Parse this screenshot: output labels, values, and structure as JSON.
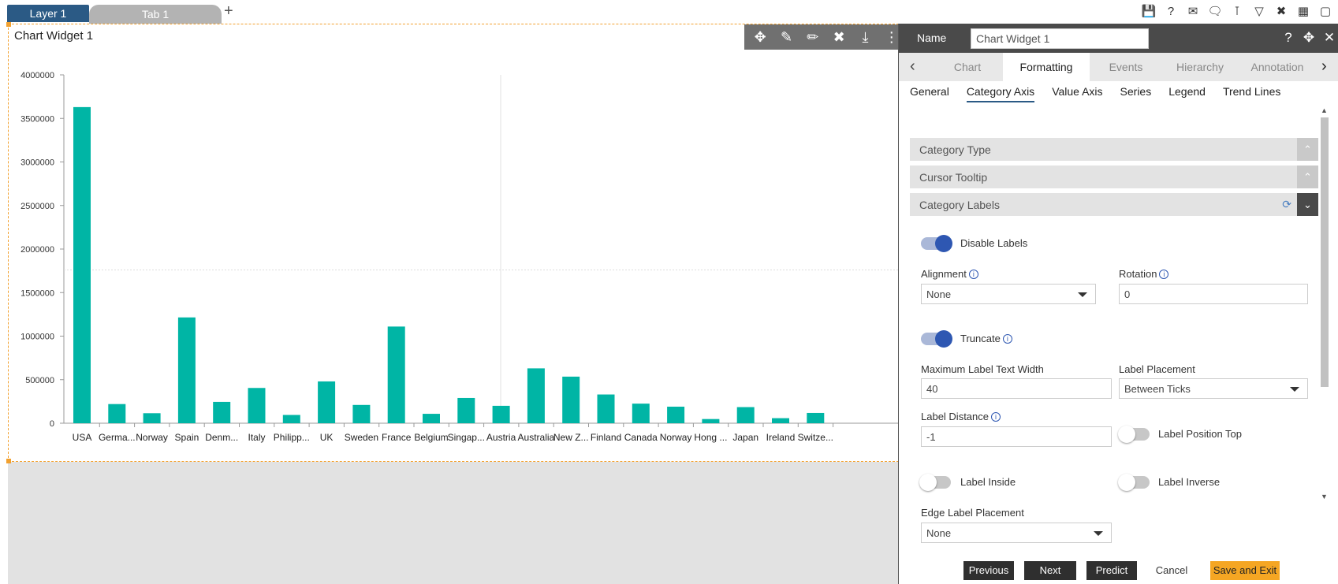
{
  "topbar": {
    "layer_tab": "Layer 1",
    "tab": "Tab 1",
    "add": "+",
    "icons": [
      "save-icon",
      "help-icon",
      "mail-icon",
      "comment-icon",
      "filter-clear-icon",
      "filter-icon",
      "tools-icon",
      "table-icon",
      "monitor-icon"
    ]
  },
  "widget": {
    "title": "Chart Widget 1",
    "toolbar_icons": [
      "move-icon",
      "draw-icon",
      "edit-icon",
      "settings-icon",
      "download-icon",
      "more-icon"
    ]
  },
  "chart_data": {
    "type": "bar",
    "categories": [
      "USA",
      "Germa...",
      "Norway",
      "Spain",
      "Denm...",
      "Italy",
      "Philipp...",
      "UK",
      "Sweden",
      "France",
      "Belgium",
      "Singap...",
      "Austria",
      "Australia",
      "New Z...",
      "Finland",
      "Canada",
      "Norway",
      "Hong ...",
      "Japan",
      "Ireland",
      "Switze..."
    ],
    "values": [
      3630000,
      220000,
      115000,
      1215000,
      245000,
      405000,
      95000,
      480000,
      210000,
      1110000,
      108000,
      290000,
      200000,
      630000,
      535000,
      330000,
      225000,
      190000,
      48000,
      185000,
      58000,
      118000
    ],
    "yticks": [
      "0",
      "500000",
      "1000000",
      "1500000",
      "2000000",
      "2500000",
      "3000000",
      "3500000",
      "4000000"
    ],
    "ylim": [
      0,
      4000000
    ],
    "color": "#00b5a5"
  },
  "panel": {
    "name_label": "Name",
    "name_value": "Chart Widget 1",
    "head_icons": [
      "help-icon",
      "move-icon",
      "close-icon"
    ],
    "tabs": [
      "Chart",
      "Formatting",
      "Events",
      "Hierarchy",
      "Annotation"
    ],
    "sub_tabs": [
      "General",
      "Category Axis",
      "Value Axis",
      "Series",
      "Legend",
      "Trend Lines"
    ],
    "sections": {
      "category_type": "Category Type",
      "cursor_tooltip": "Cursor Tooltip",
      "category_labels": "Category Labels"
    },
    "fields": {
      "disable_labels": "Disable Labels",
      "alignment_label": "Alignment",
      "alignment_value": "None",
      "rotation_label": "Rotation",
      "rotation_value": "0",
      "truncate": "Truncate",
      "max_width_label": "Maximum Label Text Width",
      "max_width_value": "40",
      "label_placement_label": "Label Placement",
      "label_placement_value": "Between Ticks",
      "label_distance_label": "Label Distance",
      "label_distance_value": "-1",
      "label_position_top": "Label Position Top",
      "label_inside": "Label Inside",
      "label_inverse": "Label Inverse",
      "edge_placement_label": "Edge Label Placement",
      "edge_placement_value": "None"
    },
    "footer": {
      "previous": "Previous",
      "next": "Next",
      "predict": "Predict",
      "cancel": "Cancel",
      "save_exit": "Save and Exit"
    }
  }
}
